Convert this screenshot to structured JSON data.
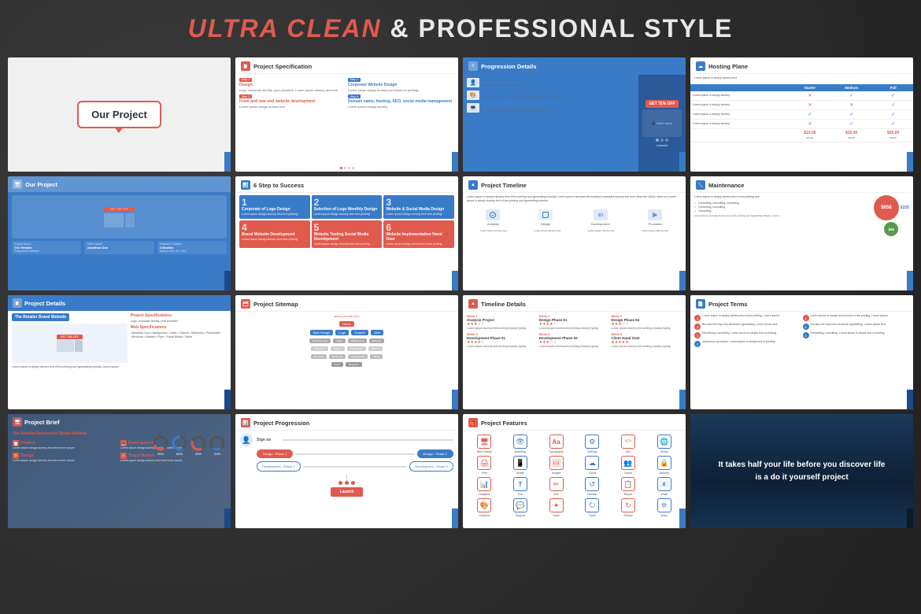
{
  "header": {
    "title_part1": "ULTRA CLEAN",
    "title_ampersand": "&",
    "title_part2": "PROFESSIONAL STYLE"
  },
  "slides": [
    {
      "id": 1,
      "type": "our_project_simple",
      "label": "Our Project"
    },
    {
      "id": 2,
      "type": "project_specification",
      "title": "Project  Specification",
      "items": [
        {
          "label": "Step 1",
          "tag": "Design:",
          "text": "Logo, corporate identity, print providers."
        },
        {
          "label": "Step 2",
          "tag": "Corporate Website Design",
          "text": "Lorem ipsum design dummy text here"
        },
        {
          "label": "Step 3",
          "tag": "Front and rear-end website development",
          "text": "Lorem ipsum design dummy"
        },
        {
          "label": "Step 4",
          "tag": "Domain name, hosting, SEO, social media management",
          "text": "Lorem ipsum design dummy"
        }
      ]
    },
    {
      "id": 3,
      "type": "progression_details",
      "title": "Progression Details",
      "rows": [
        {
          "label": "Sign on",
          "text": "Lorem ipsum dummy text"
        },
        {
          "label": "Design",
          "text": "Lorem ipsum dolor sit, E-Corporate Website design dummy text"
        },
        {
          "label": "Development",
          "text": "Lorem ipsum some development of content dummy text for printing"
        }
      ]
    },
    {
      "id": 4,
      "type": "hosting_plan",
      "title": "Hosting Plane",
      "plans": [
        "Starter",
        "Medium",
        "Full"
      ],
      "rows": [
        {
          "text": "Lorem ipsum is simply dummy",
          "starter": false,
          "medium": true,
          "full": true
        },
        {
          "text": "Lorem ipsum is simply dummy",
          "starter": false,
          "medium": false,
          "full": true
        },
        {
          "text": "Lorem ipsum is simply dummy",
          "starter": true,
          "medium": true,
          "full": true
        },
        {
          "text": "Lorem ipsum is simply dummy",
          "starter": false,
          "medium": true,
          "full": true
        }
      ],
      "prices": [
        "$10.05",
        "$15.00",
        "$25.00"
      ],
      "price_sub": "Month"
    },
    {
      "id": 5,
      "type": "our_project_device",
      "title": "Our Project",
      "project_name": "The Retailer Responsive Website",
      "client": "Jonathon Doe",
      "estimate": "3 Months"
    },
    {
      "id": 6,
      "type": "step_to_success",
      "title": "6 Step to Success",
      "steps": [
        {
          "num": "1",
          "title": "Corporate of Logo Design",
          "text": "Lorem ipsum design dummy text here",
          "color": "blue"
        },
        {
          "num": "2",
          "title": "Selection of Logo Monthly Design",
          "text": "Lorem ipsum design dummy text here",
          "color": "blue"
        },
        {
          "num": "3",
          "title": "Website & Social Media Design",
          "text": "Lorem ipsum design dummy text here",
          "color": "blue"
        },
        {
          "num": "4",
          "title": "Brand Website Development",
          "text": "Lorem ipsum design dummy text here",
          "color": "coral"
        },
        {
          "num": "5",
          "title": "Website Testing Social Media Development",
          "text": "Lorem ipsum design dummy text here",
          "color": "coral"
        },
        {
          "num": "6",
          "title": "Website Implementation Hand Over",
          "text": "Lorem ipsum design dummy text here",
          "color": "coral"
        }
      ]
    },
    {
      "id": 7,
      "type": "project_timeline",
      "title": "Project Timeline",
      "intro": "Lorem ipsum is simply dummy text of the printing and typesetting industry. Lorem ipsum has been the industry's standard dummy text ever since the 1500s, when an Lorem ipsum is simply dummy text of the printing and typesetting industry. Lorem ipsum has been the",
      "phases": [
        "Analysis",
        "Design",
        "Development",
        "Promotion"
      ]
    },
    {
      "id": 8,
      "type": "maintenance",
      "title": "Maintenance",
      "text": "Lorem ipsum is simply dummy text of the printing and",
      "prices": [
        {
          "amount": "$658",
          "size": "big"
        },
        {
          "amount": "$155",
          "size": "med"
        },
        {
          "amount": "$65",
          "size": "sm"
        }
      ],
      "items": [
        "Consulting, consulting, consulting, it can subsume in...",
        "Consulting, consulting, consulting",
        "Consulting, consulting"
      ]
    },
    {
      "id": 9,
      "type": "project_details",
      "title": "Project  Details",
      "subtitle_left": "The Retailer Brand Website",
      "spec_title": "Project Specifications",
      "spec_text": "Logo, corporate identity, print providers",
      "web_title": "Web Specifications",
      "web_items": [
        "Business Card",
        "Letter",
        "Stationery",
        "Brochure",
        "Flyer"
      ],
      "right_items": [
        "Background",
        "Objects",
        "Placeholder",
        "Buttons",
        "Social Media",
        "Tablet"
      ]
    },
    {
      "id": 10,
      "type": "project_sitemap",
      "title": "Project Sitemap",
      "url": "www.yoursite.com",
      "home": "Home",
      "nodes": [
        "Web Design",
        "Logo",
        "Graphic",
        "Web"
      ],
      "sub_nodes": [
        "Business Card",
        "Letter",
        "Background",
        "Banners",
        "Objects",
        "Placeholder",
        "Music pay",
        "Buttons",
        "Social Media",
        "Tablet"
      ],
      "bottom_nodes": [
        "Flyer",
        "Magazine"
      ]
    },
    {
      "id": 11,
      "type": "timeline_details",
      "title": "Timeline Details",
      "weeks": [
        {
          "week": "Week 1",
          "title": "Analysis Project",
          "stars": 3,
          "text": "Lorem ipsum dummy text printing industry"
        },
        {
          "week": "Week 2",
          "title": "Design Phase 01",
          "stars": 4,
          "text": "Lorem ipsum dummy text printing industry"
        },
        {
          "week": "Week 3",
          "title": "Design Phase 02",
          "stars": 3,
          "text": "Lorem ipsum dummy text printing industry"
        },
        {
          "week": "Week 4",
          "title": "Development Phase 01",
          "stars": 4,
          "text": "Lorem ipsum dummy text printing industry"
        },
        {
          "week": "Week 5",
          "title": "Development Phase 02",
          "stars": 3,
          "text": "Lorem ipsum dummy text printing industry"
        },
        {
          "week": "Week 6",
          "title": "Client Hand Over",
          "stars": 5,
          "text": "Lorem ipsum dummy text printing industry"
        }
      ]
    },
    {
      "id": 12,
      "type": "project_terms",
      "title": "Project  Terms",
      "terms": [
        {
          "num": "1",
          "text": "Lorem ipsum is simply dummy text of the printing. Lorem ipsum.",
          "color": "coral"
        },
        {
          "num": "4",
          "text": "Lorem ipsum is simply dummy text of the printing. Lorem ipsum.",
          "color": "coral"
        },
        {
          "num": "2",
          "text": "But also the leap into electronic typesetting. Lorem ipsum text.",
          "color": "coral"
        },
        {
          "num": "5",
          "text": "But also the leap into electronic typesetting. Lorem ipsum text.",
          "color": "blue"
        },
        {
          "num": "3",
          "text": "Remaining, consulting. Lorem ipsum is simply text of printing.",
          "color": "coral"
        },
        {
          "num": "6",
          "text": "Remaining, consulting. Lorem ipsum is simply text of printing.",
          "color": "blue"
        },
        {
          "num": "7",
          "text": "Numerous synonyms. Lorem ipsum is simply text of printing.",
          "color": "blue"
        }
      ]
    },
    {
      "id": 13,
      "type": "project_brief",
      "title": "Project  Brief",
      "subtitle": "The Retailer Responsive Brand Website",
      "items": [
        {
          "label": "Product",
          "text": "Lorem ipsum design dummy text here lorem"
        },
        {
          "label": "Development",
          "text": "Lorem ipsum design dummy text here lorem"
        },
        {
          "label": "Design",
          "text": "Lorem ipsum design dummy text here lorem"
        },
        {
          "label": "Target Market",
          "text": "Lorem ipsum design dummy text here lorem"
        }
      ],
      "percentages": [
        "30%",
        "60%",
        "40%",
        "20%"
      ]
    },
    {
      "id": 14,
      "type": "project_progression",
      "title": "Project Progression",
      "sign_on": "Sign on",
      "design_phase1": "Design : Phase 1",
      "design_phase2": "Design : Phase 2",
      "dev_phase1": "Development : Phase 1",
      "dev_phase2": "Development : Phase 2",
      "launch": "Launch"
    },
    {
      "id": 15,
      "type": "project_features",
      "title": "Project  Features",
      "features": [
        {
          "icon": "🖥",
          "label": "Web Design"
        },
        {
          "icon": "👁",
          "label": "Branding"
        },
        {
          "icon": "A",
          "label": "Typography"
        },
        {
          "icon": "⚙",
          "label": "Settings"
        },
        {
          "icon": "</>",
          "label": "Development"
        },
        {
          "icon": "🌐",
          "label": "Global"
        },
        {
          "icon": "🖨",
          "label": "Print"
        },
        {
          "icon": "📱",
          "label": "Mobile"
        },
        {
          "icon": "🖼",
          "label": "Images"
        },
        {
          "icon": "☁",
          "label": "Cloud"
        },
        {
          "icon": "👥",
          "label": "Social"
        },
        {
          "icon": "🔒",
          "label": "Security"
        },
        {
          "icon": "📊",
          "label": "Analytics"
        },
        {
          "icon": "T",
          "label": "Text"
        },
        {
          "icon": "✏",
          "label": "Edit"
        },
        {
          "icon": "♻",
          "label": "Refresh"
        },
        {
          "icon": "📋",
          "label": "Report"
        },
        {
          "icon": "📧",
          "label": "Email"
        },
        {
          "icon": "🎨",
          "label": "Graphics"
        },
        {
          "icon": "💬",
          "label": "Support"
        },
        {
          "icon": "✦",
          "label": "Icons"
        },
        {
          "icon": "⭮",
          "label": "Cycle"
        },
        {
          "icon": "↺",
          "label": "Reload"
        },
        {
          "icon": "❊",
          "label": "Extra"
        }
      ]
    },
    {
      "id": 16,
      "type": "quote",
      "text": "It takes half your life before you discover life\nis a do it yourself project"
    }
  ]
}
